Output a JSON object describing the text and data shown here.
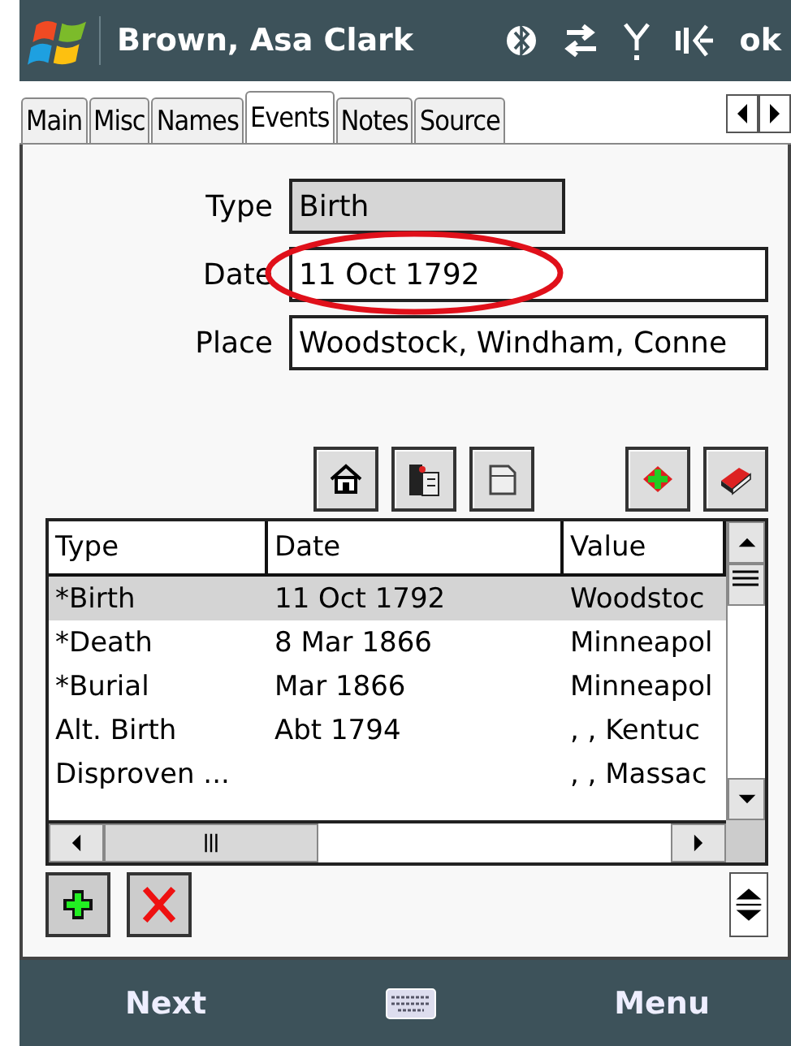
{
  "title_bar": {
    "title": "Brown, Asa Clark",
    "ok": "ok"
  },
  "tabs": [
    {
      "label": "Main",
      "selected": false
    },
    {
      "label": "Misc",
      "selected": false
    },
    {
      "label": "Names",
      "selected": false
    },
    {
      "label": "Events",
      "selected": true
    },
    {
      "label": "Notes",
      "selected": false
    },
    {
      "label": "Source",
      "selected": false
    }
  ],
  "form": {
    "fields": [
      {
        "label": "Type",
        "value": "Birth",
        "disabled": true,
        "circled": false
      },
      {
        "label": "Date",
        "value": "11 Oct 1792",
        "disabled": false,
        "circled": true
      },
      {
        "label": "Place",
        "value": "Woodstock, Windham, Conne",
        "disabled": false,
        "circled": false
      }
    ]
  },
  "table": {
    "columns": [
      "Type",
      "Date",
      "Value"
    ],
    "rows": [
      {
        "cells": [
          "*Birth",
          "11 Oct 1792",
          "Woodstoc"
        ],
        "selected": true
      },
      {
        "cells": [
          "*Death",
          "8 Mar 1866",
          "Minneapol"
        ],
        "selected": false
      },
      {
        "cells": [
          "*Burial",
          "Mar 1866",
          "Minneapol"
        ],
        "selected": false
      },
      {
        "cells": [
          "Alt. Birth",
          "Abt 1794",
          ", , Kentuc"
        ],
        "selected": false
      },
      {
        "cells": [
          "Disproven ...",
          "",
          ", , Massac"
        ],
        "selected": false
      }
    ]
  },
  "softkeys": {
    "left": "Next",
    "right": "Menu"
  }
}
